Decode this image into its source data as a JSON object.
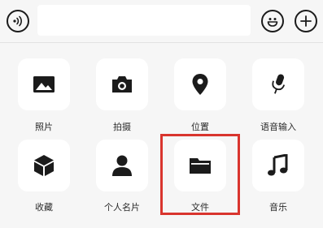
{
  "input_bar": {
    "voice_icon": "voice-icon",
    "emoji_icon": "emoji-icon",
    "plus_icon": "plus-icon",
    "text_value": ""
  },
  "panel": {
    "items": [
      {
        "label": "照片",
        "icon": "photo-icon"
      },
      {
        "label": "拍摄",
        "icon": "camera-icon"
      },
      {
        "label": "位置",
        "icon": "location-icon"
      },
      {
        "label": "语音输入",
        "icon": "microphone-icon"
      },
      {
        "label": "收藏",
        "icon": "favorites-cube-icon"
      },
      {
        "label": "个人名片",
        "icon": "contact-card-icon"
      },
      {
        "label": "文件",
        "icon": "folder-icon"
      },
      {
        "label": "音乐",
        "icon": "music-note-icon"
      }
    ]
  },
  "colors": {
    "background": "#f6f6f6",
    "tile": "#ffffff",
    "icon": "#1b1b1b",
    "highlight": "#d9352e"
  }
}
